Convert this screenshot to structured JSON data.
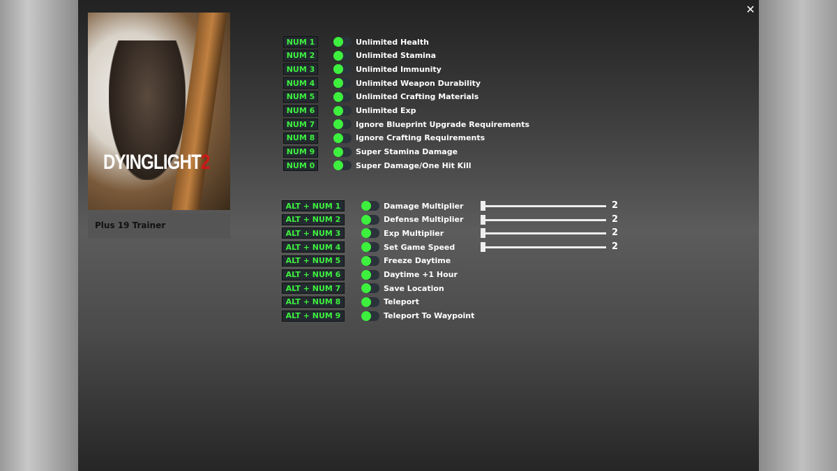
{
  "window": {
    "close_icon": "close-icon",
    "close_glyph": "✕"
  },
  "cover": {
    "logo_text": "DYING LIGHT 2",
    "logo_main": "DYINGLIGHT",
    "logo_num": "2",
    "caption": "Plus 19 Trainer"
  },
  "colors": {
    "key_text": "#3ef03e",
    "toggle_knob": "#3ef03e",
    "toggle_track": "#2a323a"
  },
  "cheats": [
    {
      "key": "NUM 1",
      "label": "Unlimited Health"
    },
    {
      "key": "NUM 2",
      "label": "Unlimited Stamina"
    },
    {
      "key": "NUM 3",
      "label": "Unlimited Immunity"
    },
    {
      "key": "NUM 4",
      "label": "Unlimited Weapon Durability"
    },
    {
      "key": "NUM 5",
      "label": "Unlimited Crafting Materials"
    },
    {
      "key": "NUM 6",
      "label": "Unlimited Exp"
    },
    {
      "key": "NUM 7",
      "label": "Ignore Blueprint Upgrade Requirements"
    },
    {
      "key": "NUM 8",
      "label": "Ignore Crafting Requirements"
    },
    {
      "key": "NUM 9",
      "label": "Super Stamina Damage"
    },
    {
      "key": "NUM 0",
      "label": "Super Damage/One Hit Kill"
    }
  ],
  "alt_cheats": [
    {
      "key": "ALT + NUM 1",
      "label": "Damage Multiplier",
      "value": "2",
      "slider_fraction": 0
    },
    {
      "key": "ALT + NUM 2",
      "label": "Defense Multiplier",
      "value": "2",
      "slider_fraction": 0
    },
    {
      "key": "ALT + NUM 3",
      "label": "Exp Multiplier",
      "value": "2",
      "slider_fraction": 0
    },
    {
      "key": "ALT + NUM 4",
      "label": "Set Game Speed",
      "value": "2",
      "slider_fraction": 0
    },
    {
      "key": "ALT + NUM 5",
      "label": "Freeze Daytime"
    },
    {
      "key": "ALT + NUM 6",
      "label": "Daytime +1 Hour"
    },
    {
      "key": "ALT + NUM 7",
      "label": "Save Location"
    },
    {
      "key": "ALT + NUM 8",
      "label": "Teleport"
    },
    {
      "key": "ALT + NUM 9",
      "label": "Teleport To Waypoint"
    }
  ]
}
